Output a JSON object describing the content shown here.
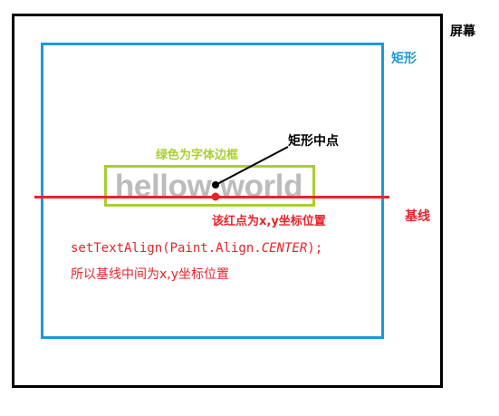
{
  "labels": {
    "screen": "屏幕",
    "rectangle": "矩形",
    "font_box": "绿色为字体边框",
    "rect_center": "矩形中点",
    "red_point": "该红点为x,y坐标位置",
    "baseline": "基线"
  },
  "sample_text": "hellow world",
  "code": {
    "prefix": "setTextAlign(Paint.Align.",
    "italic": "CENTER",
    "suffix": ");"
  },
  "note": "所以基线中间为x,y坐标位置",
  "colors": {
    "screen": "#000000",
    "rectangle": "#1c9ad6",
    "font_box": "#a8cf32",
    "baseline": "#e8242a",
    "sample_text": "#bcbcbc"
  }
}
